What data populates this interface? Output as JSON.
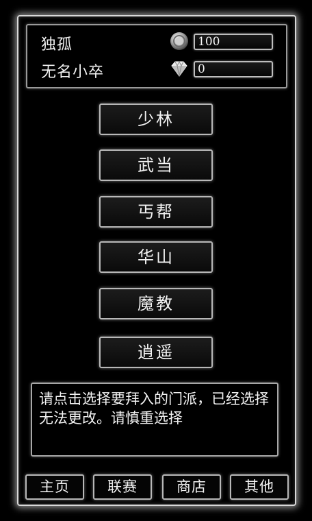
{
  "player": {
    "sect_name": "独孤",
    "rank_title": "无名小卒"
  },
  "resources": {
    "coin_icon": "silver-coin-icon",
    "coin_value": "100",
    "gem_icon": "diamond-icon",
    "gem_value": "0"
  },
  "sects": [
    {
      "label": "少林"
    },
    {
      "label": "武当"
    },
    {
      "label": "丐帮"
    },
    {
      "label": "华山"
    },
    {
      "label": "魔教"
    },
    {
      "label": "逍遥"
    }
  ],
  "info": {
    "text": "请点击选择要拜入的门派，已经选择无法更改。请慎重选择"
  },
  "nav": {
    "items": [
      {
        "label": "主页"
      },
      {
        "label": "联赛"
      },
      {
        "label": "商店"
      },
      {
        "label": "其他"
      }
    ]
  },
  "colors": {
    "background": "#000000",
    "border": "#d8d8d8",
    "text": "#f2f2f2"
  }
}
